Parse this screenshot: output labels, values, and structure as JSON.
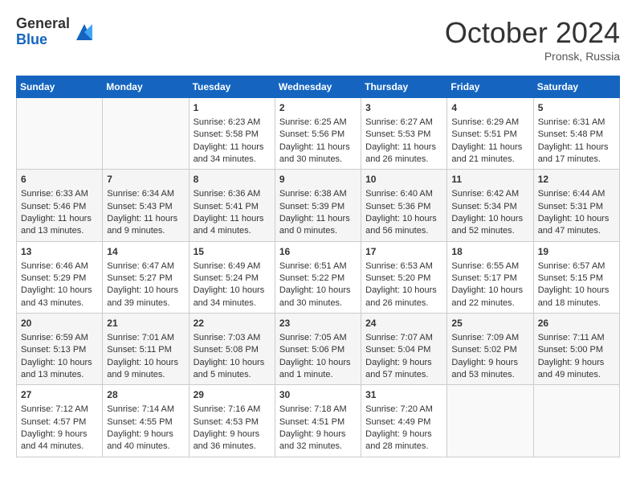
{
  "header": {
    "logo_general": "General",
    "logo_blue": "Blue",
    "month_title": "October 2024",
    "location": "Pronsk, Russia"
  },
  "weekdays": [
    "Sunday",
    "Monday",
    "Tuesday",
    "Wednesday",
    "Thursday",
    "Friday",
    "Saturday"
  ],
  "weeks": [
    [
      {
        "day": "",
        "content": ""
      },
      {
        "day": "",
        "content": ""
      },
      {
        "day": "1",
        "content": "Sunrise: 6:23 AM\nSunset: 5:58 PM\nDaylight: 11 hours and 34 minutes."
      },
      {
        "day": "2",
        "content": "Sunrise: 6:25 AM\nSunset: 5:56 PM\nDaylight: 11 hours and 30 minutes."
      },
      {
        "day": "3",
        "content": "Sunrise: 6:27 AM\nSunset: 5:53 PM\nDaylight: 11 hours and 26 minutes."
      },
      {
        "day": "4",
        "content": "Sunrise: 6:29 AM\nSunset: 5:51 PM\nDaylight: 11 hours and 21 minutes."
      },
      {
        "day": "5",
        "content": "Sunrise: 6:31 AM\nSunset: 5:48 PM\nDaylight: 11 hours and 17 minutes."
      }
    ],
    [
      {
        "day": "6",
        "content": "Sunrise: 6:33 AM\nSunset: 5:46 PM\nDaylight: 11 hours and 13 minutes."
      },
      {
        "day": "7",
        "content": "Sunrise: 6:34 AM\nSunset: 5:43 PM\nDaylight: 11 hours and 9 minutes."
      },
      {
        "day": "8",
        "content": "Sunrise: 6:36 AM\nSunset: 5:41 PM\nDaylight: 11 hours and 4 minutes."
      },
      {
        "day": "9",
        "content": "Sunrise: 6:38 AM\nSunset: 5:39 PM\nDaylight: 11 hours and 0 minutes."
      },
      {
        "day": "10",
        "content": "Sunrise: 6:40 AM\nSunset: 5:36 PM\nDaylight: 10 hours and 56 minutes."
      },
      {
        "day": "11",
        "content": "Sunrise: 6:42 AM\nSunset: 5:34 PM\nDaylight: 10 hours and 52 minutes."
      },
      {
        "day": "12",
        "content": "Sunrise: 6:44 AM\nSunset: 5:31 PM\nDaylight: 10 hours and 47 minutes."
      }
    ],
    [
      {
        "day": "13",
        "content": "Sunrise: 6:46 AM\nSunset: 5:29 PM\nDaylight: 10 hours and 43 minutes."
      },
      {
        "day": "14",
        "content": "Sunrise: 6:47 AM\nSunset: 5:27 PM\nDaylight: 10 hours and 39 minutes."
      },
      {
        "day": "15",
        "content": "Sunrise: 6:49 AM\nSunset: 5:24 PM\nDaylight: 10 hours and 34 minutes."
      },
      {
        "day": "16",
        "content": "Sunrise: 6:51 AM\nSunset: 5:22 PM\nDaylight: 10 hours and 30 minutes."
      },
      {
        "day": "17",
        "content": "Sunrise: 6:53 AM\nSunset: 5:20 PM\nDaylight: 10 hours and 26 minutes."
      },
      {
        "day": "18",
        "content": "Sunrise: 6:55 AM\nSunset: 5:17 PM\nDaylight: 10 hours and 22 minutes."
      },
      {
        "day": "19",
        "content": "Sunrise: 6:57 AM\nSunset: 5:15 PM\nDaylight: 10 hours and 18 minutes."
      }
    ],
    [
      {
        "day": "20",
        "content": "Sunrise: 6:59 AM\nSunset: 5:13 PM\nDaylight: 10 hours and 13 minutes."
      },
      {
        "day": "21",
        "content": "Sunrise: 7:01 AM\nSunset: 5:11 PM\nDaylight: 10 hours and 9 minutes."
      },
      {
        "day": "22",
        "content": "Sunrise: 7:03 AM\nSunset: 5:08 PM\nDaylight: 10 hours and 5 minutes."
      },
      {
        "day": "23",
        "content": "Sunrise: 7:05 AM\nSunset: 5:06 PM\nDaylight: 10 hours and 1 minute."
      },
      {
        "day": "24",
        "content": "Sunrise: 7:07 AM\nSunset: 5:04 PM\nDaylight: 9 hours and 57 minutes."
      },
      {
        "day": "25",
        "content": "Sunrise: 7:09 AM\nSunset: 5:02 PM\nDaylight: 9 hours and 53 minutes."
      },
      {
        "day": "26",
        "content": "Sunrise: 7:11 AM\nSunset: 5:00 PM\nDaylight: 9 hours and 49 minutes."
      }
    ],
    [
      {
        "day": "27",
        "content": "Sunrise: 7:12 AM\nSunset: 4:57 PM\nDaylight: 9 hours and 44 minutes."
      },
      {
        "day": "28",
        "content": "Sunrise: 7:14 AM\nSunset: 4:55 PM\nDaylight: 9 hours and 40 minutes."
      },
      {
        "day": "29",
        "content": "Sunrise: 7:16 AM\nSunset: 4:53 PM\nDaylight: 9 hours and 36 minutes."
      },
      {
        "day": "30",
        "content": "Sunrise: 7:18 AM\nSunset: 4:51 PM\nDaylight: 9 hours and 32 minutes."
      },
      {
        "day": "31",
        "content": "Sunrise: 7:20 AM\nSunset: 4:49 PM\nDaylight: 9 hours and 28 minutes."
      },
      {
        "day": "",
        "content": ""
      },
      {
        "day": "",
        "content": ""
      }
    ]
  ]
}
